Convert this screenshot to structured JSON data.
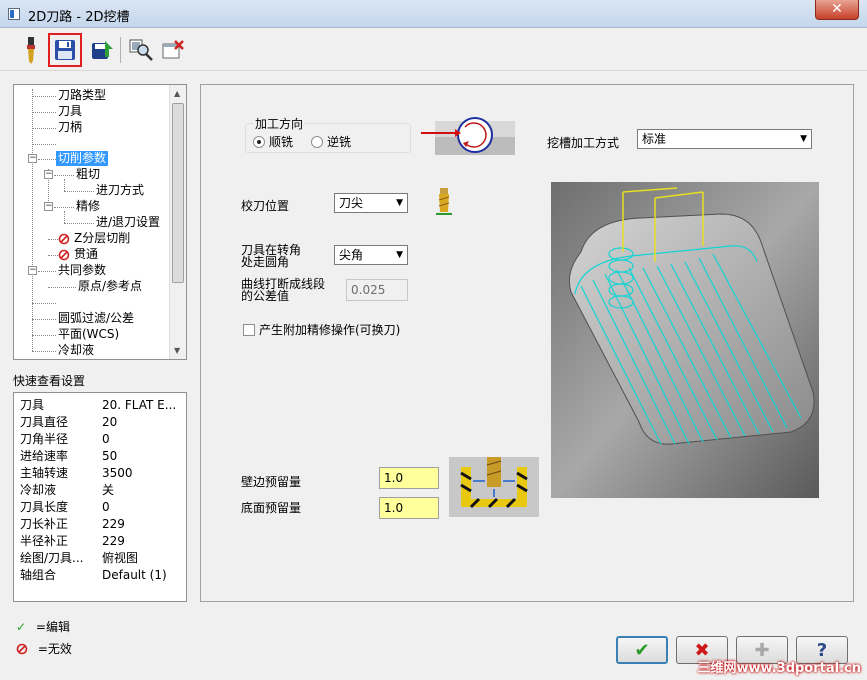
{
  "window": {
    "title": "2D刀路 - 2D挖槽",
    "close": "✕"
  },
  "tree": {
    "items": [
      "刀路类型",
      "刀具",
      "刀柄",
      "切削参数",
      "粗切",
      "进刀方式",
      "精修",
      "进/退刀设置",
      "Z分层切削",
      "贯通",
      "共同参数",
      "原点/参考点",
      "圆弧过滤/公差",
      "平面(WCS)",
      "冷却液"
    ]
  },
  "quick": {
    "title": "快速查看设置",
    "rows": [
      {
        "k": "刀具",
        "v": "20. FLAT E..."
      },
      {
        "k": "刀具直径",
        "v": "20"
      },
      {
        "k": "刀角半径",
        "v": "0"
      },
      {
        "k": "进给速率",
        "v": "50"
      },
      {
        "k": "主轴转速",
        "v": "3500"
      },
      {
        "k": "冷却液",
        "v": "关"
      },
      {
        "k": "刀具长度",
        "v": "0"
      },
      {
        "k": "刀长补正",
        "v": "229"
      },
      {
        "k": "半径补正",
        "v": "229"
      },
      {
        "k": "绘图/刀具...",
        "v": "俯视图"
      },
      {
        "k": "轴组合",
        "v": "Default (1)"
      }
    ]
  },
  "legend": {
    "edit": "=编辑",
    "invalid": "=无效"
  },
  "main": {
    "direction_label": "加工方向",
    "climb": "顺铣",
    "conventional": "逆铣",
    "slot_method_label": "挖槽加工方式",
    "slot_method_value": "标准",
    "tip_label": "校刀位置",
    "tip_value": "刀尖",
    "corner_label_1": "刀具在转角",
    "corner_label_2": "处走圆角",
    "corner_value": "尖角",
    "tol_label_1": "曲线打断成线段",
    "tol_label_2": "的公差值",
    "tol_value": "0.025",
    "finish_check": "产生附加精修操作(可换刀)",
    "wall_label": "壁边预留量",
    "wall_value": "1.0",
    "floor_label": "底面预留量",
    "floor_value": "1.0"
  },
  "watermark": "三维网www.3dportal.cn",
  "colors": {
    "selection": "#3399ff",
    "stock_input": "#ffff9c",
    "toolpath": "#00e0e0"
  }
}
